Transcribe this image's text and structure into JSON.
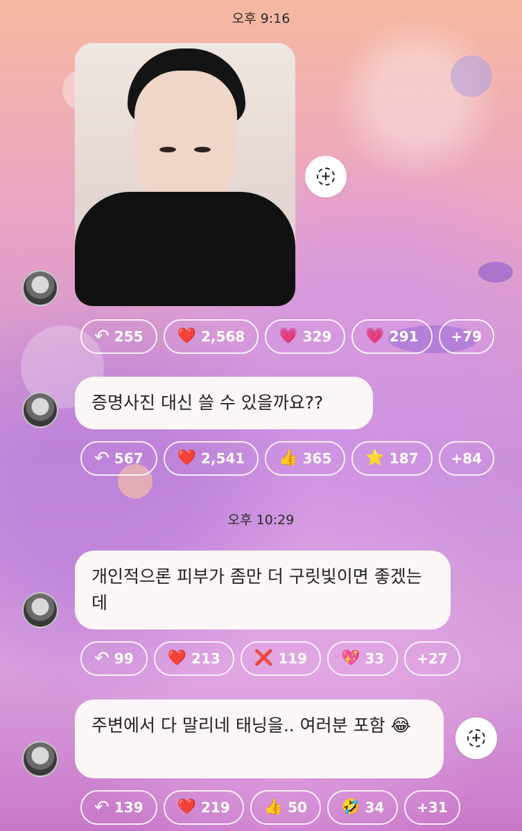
{
  "status": {
    "time_top": "오후 9:16",
    "time_mid": "오후 10:29"
  },
  "messages": [
    {
      "kind": "photo",
      "reactions": [
        {
          "icon": "reply-icon",
          "glyph": "↶",
          "count": "255"
        },
        {
          "icon": "red-heart-icon",
          "glyph": "❤️",
          "count": "2,568"
        },
        {
          "icon": "sparkling-heart-icon",
          "glyph": "💗",
          "count": "329"
        },
        {
          "icon": "pink-heart-icon",
          "glyph": "💗",
          "count": "291"
        },
        {
          "icon": "more-reactions",
          "glyph": "",
          "count": "+79"
        }
      ]
    },
    {
      "kind": "text",
      "text": "증명사진 대신 쓸 수 있을까요??",
      "reactions": [
        {
          "icon": "reply-icon",
          "glyph": "↶",
          "count": "567"
        },
        {
          "icon": "red-heart-icon",
          "glyph": "❤️",
          "count": "2,541"
        },
        {
          "icon": "thumbs-up-icon",
          "glyph": "👍",
          "count": "365"
        },
        {
          "icon": "star-icon",
          "glyph": "⭐",
          "count": "187"
        },
        {
          "icon": "more-reactions",
          "glyph": "",
          "count": "+84"
        }
      ]
    },
    {
      "kind": "text",
      "text": "개인적으론 피부가 좀만 더 구릿빛이면 좋겠는데",
      "reactions": [
        {
          "icon": "reply-icon",
          "glyph": "↶",
          "count": "99"
        },
        {
          "icon": "red-heart-icon",
          "glyph": "❤️",
          "count": "213"
        },
        {
          "icon": "cross-mark-icon",
          "glyph": "❌",
          "count": "119"
        },
        {
          "icon": "sparkle-heart-icon",
          "glyph": "💖",
          "count": "33"
        },
        {
          "icon": "more-reactions",
          "glyph": "",
          "count": "+27"
        }
      ]
    },
    {
      "kind": "text",
      "text": "주변에서 다 말리네 태닝을.. 여러분 포함 😂",
      "reactions": [
        {
          "icon": "reply-icon",
          "glyph": "↶",
          "count": "139"
        },
        {
          "icon": "red-heart-icon",
          "glyph": "❤️",
          "count": "219"
        },
        {
          "icon": "thumbs-up-icon",
          "glyph": "👍",
          "count": "50"
        },
        {
          "icon": "rofl-icon",
          "glyph": "🤣",
          "count": "34"
        },
        {
          "icon": "more-reactions",
          "glyph": "",
          "count": "+31"
        }
      ]
    }
  ],
  "colors": {
    "bubble": "#fcf6f6",
    "chip_border": "#ffffff"
  }
}
